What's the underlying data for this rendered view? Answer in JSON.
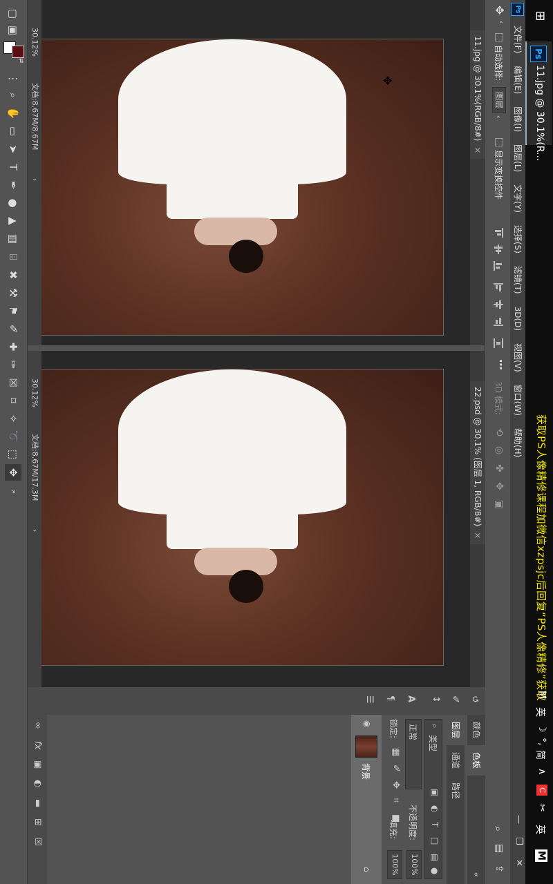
{
  "taskbar": {
    "app_title": "11.jpg @ 30.1%(R...",
    "ps_badge": "Ps",
    "overlay_text": "获取PS人像精修课程加微信xzpsjc后回复“PS人像精修”获取",
    "tray": [
      "M",
      "英",
      "☽",
      "°,",
      "简",
      "∧",
      "C",
      "✂",
      "英",
      "M"
    ]
  },
  "menubar": {
    "ps_badge": "Ps",
    "items": [
      "文件(F)",
      "编辑(E)",
      "图像(I)",
      "图层(L)",
      "文字(Y)",
      "选择(S)",
      "滤镜(T)",
      "3D(D)",
      "视图(V)",
      "窗口(W)",
      "帮助(H)"
    ],
    "minimize": "—",
    "restore": "❒",
    "close": "✕"
  },
  "options": {
    "auto_select_label": "自动选择:",
    "auto_select_target": "图层",
    "show_transform_label": "显示变换控件",
    "mode_3d_label": "3D 模式:"
  },
  "documents": [
    {
      "tab_title": "11.jpg @ 30.1%(RGB/8#)",
      "close": "×",
      "zoom": "30.12%",
      "doc_info": "文档:8.67M/8.67M",
      "arrow": "›"
    },
    {
      "tab_title": "22.psd @ 30.1% (图层 1, RGB/8#)",
      "close": "×",
      "zoom": "30.12%",
      "doc_info": "文档:8.67M/17.3M",
      "arrow": "›"
    }
  ],
  "panels": {
    "top_tabs": [
      "颜色",
      "色板"
    ],
    "layer_tabs": [
      "图层",
      "通道",
      "路径"
    ],
    "filter_label": "类型",
    "blend_mode": "正常",
    "opacity_label": "不透明度:",
    "opacity_value": "100%",
    "lock_label": "锁定:",
    "fill_label": "填充:",
    "fill_value": "100%",
    "layer_name": "背景",
    "collapse": "«"
  },
  "colors": {
    "foreground": "#5a0d12",
    "background": "#ffffff",
    "accent": "#31a8ff"
  }
}
